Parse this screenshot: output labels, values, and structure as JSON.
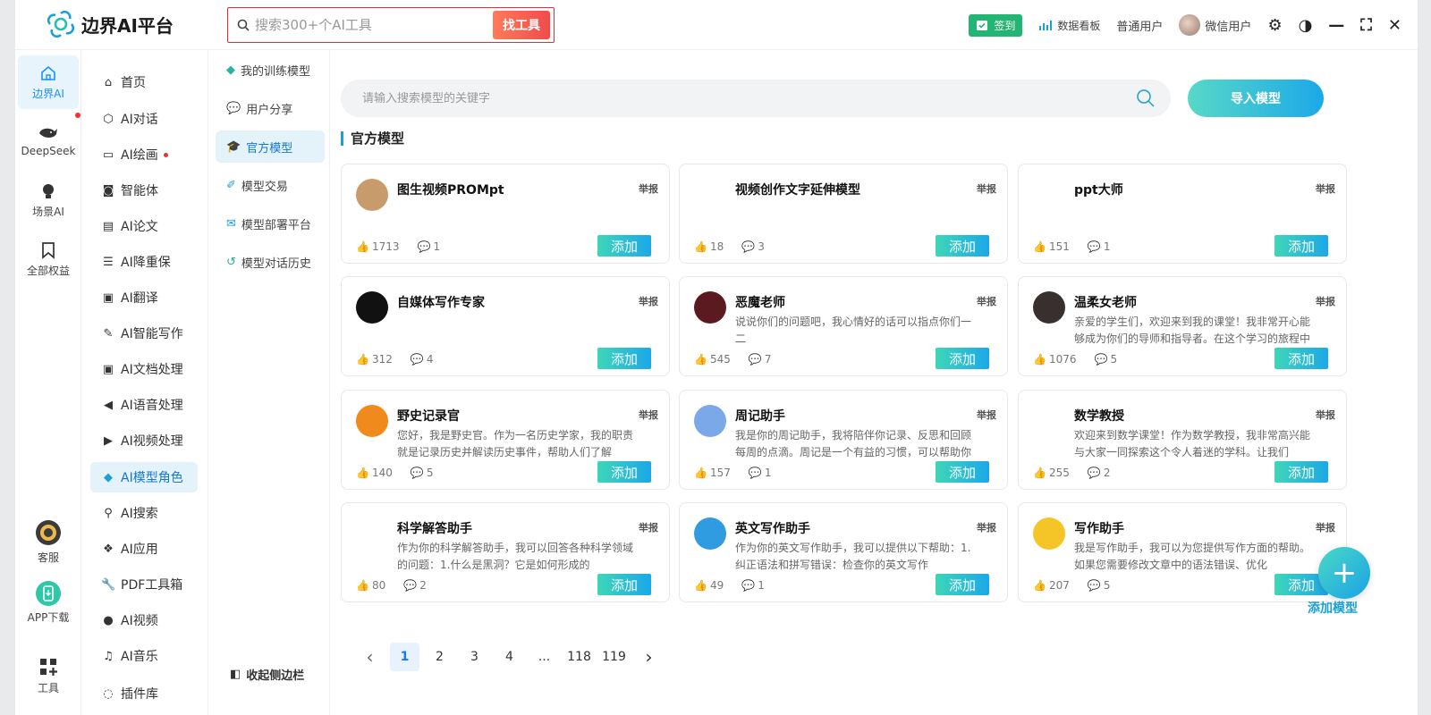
{
  "app": {
    "title": "边界AI平台"
  },
  "search": {
    "placeholder": "搜索300+个AI工具",
    "button": "找工具"
  },
  "topbar": {
    "signin": "签到",
    "dashboard": "数据看板",
    "user_level": "普通用户",
    "user_name": "微信用户"
  },
  "rail": [
    {
      "label": "边界AI",
      "icon": "home-icon"
    },
    {
      "label": "DeepSeek",
      "icon": "whale-icon"
    },
    {
      "label": "场景AI",
      "icon": "bulb-icon"
    },
    {
      "label": "全部权益",
      "icon": "bookmark-icon"
    },
    {
      "label": "客服",
      "icon": "support-icon"
    },
    {
      "label": "APP下载",
      "icon": "phone-icon"
    },
    {
      "label": "工具",
      "icon": "grid-icon"
    }
  ],
  "menu": [
    {
      "label": "首页",
      "icon": "home-icon"
    },
    {
      "label": "AI对话",
      "icon": "cube-icon"
    },
    {
      "label": "AI绘画",
      "icon": "image-icon"
    },
    {
      "label": "智能体",
      "icon": "robot-icon"
    },
    {
      "label": "AI论文",
      "icon": "doc-icon"
    },
    {
      "label": "AI降重保",
      "icon": "list-icon"
    },
    {
      "label": "AI翻译",
      "icon": "translate-icon"
    },
    {
      "label": "AI智能写作",
      "icon": "pen-icon"
    },
    {
      "label": "AI文档处理",
      "icon": "text-icon"
    },
    {
      "label": "AI语音处理",
      "icon": "speaker-icon"
    },
    {
      "label": "AI视频处理",
      "icon": "video-icon"
    },
    {
      "label": "AI模型角色",
      "icon": "cube-icon"
    },
    {
      "label": "AI搜索",
      "icon": "search-icon"
    },
    {
      "label": "AI应用",
      "icon": "apps-icon"
    },
    {
      "label": "PDF工具箱",
      "icon": "wrench-icon"
    },
    {
      "label": "AI视频",
      "icon": "play-icon"
    },
    {
      "label": "AI音乐",
      "icon": "music-icon"
    },
    {
      "label": "插件库",
      "icon": "plugin-icon"
    }
  ],
  "submenu": [
    {
      "label": "我的训练模型"
    },
    {
      "label": "用户分享"
    },
    {
      "label": "官方模型"
    },
    {
      "label": "模型交易"
    },
    {
      "label": "模型部署平台"
    },
    {
      "label": "模型对话历史"
    }
  ],
  "collapse": "收起侧边栏",
  "main": {
    "search_placeholder": "请输入搜索模型的关键字",
    "import": "导入模型",
    "section": "官方模型",
    "report": "举报",
    "add": "添加"
  },
  "cards": [
    {
      "title": "图生视频PROMpt",
      "desc": "",
      "likes": "1713",
      "comments": "1",
      "avatar": "dog-avatar",
      "color": "#c89b6d"
    },
    {
      "title": "视频创作文字延伸模型",
      "desc": "",
      "likes": "18",
      "comments": "3",
      "avatar": "blank-avatar",
      "color": "#ffffff"
    },
    {
      "title": "ppt大师",
      "desc": "",
      "likes": "151",
      "comments": "1",
      "avatar": "openai-avatar",
      "color": "#ffffff"
    },
    {
      "title": "自媒体写作专家",
      "desc": "",
      "likes": "312",
      "comments": "4",
      "avatar": "openai-dark-avatar",
      "color": "#111111"
    },
    {
      "title": "恶魔老师",
      "desc": "说说你们的问题吧，我心情好的话可以指点你们一二",
      "likes": "545",
      "comments": "7",
      "avatar": "demon-avatar",
      "color": "#5a1a1f"
    },
    {
      "title": "温柔女老师",
      "desc": "亲爱的学生们，欢迎来到我的课堂！我非常开心能够成为你们的导师和指导者。在这个学习的旅程中",
      "likes": "1076",
      "comments": "5",
      "avatar": "teacher-avatar",
      "color": "#3a2f2f"
    },
    {
      "title": "野史记录官",
      "desc": "您好，我是野史官。作为一名历史学家，我的职责就是记录历史并解读历史事件，帮助人们了解",
      "likes": "140",
      "comments": "5",
      "avatar": "book-avatar",
      "color": "#f08a1c"
    },
    {
      "title": "周记助手",
      "desc": "我是你的周记助手，我将陪伴你记录、反思和回顾每周的点滴。周记是一个有益的习惯，可以帮助你",
      "likes": "157",
      "comments": "1",
      "avatar": "notepad-avatar",
      "color": "#7aa8e8"
    },
    {
      "title": "数学教授",
      "desc": "欢迎来到数学课堂！作为数学教授，我非常高兴能与大家一同探索这个令人着迷的学科。让我们",
      "likes": "255",
      "comments": "2",
      "avatar": "professor-avatar",
      "color": "#ffffff"
    },
    {
      "title": "科学解答助手",
      "desc": "作为你的科学解答助手，我可以回答各种科学领域的问题：1.什么是黑洞？它是如何形成的",
      "likes": "80",
      "comments": "2",
      "avatar": "bulb-avatar",
      "color": "#ffffff"
    },
    {
      "title": "英文写作助手",
      "desc": "作为你的英文写作助手，我可以提供以下帮助：1.纠正语法和拼写错误：检查你的英文写作",
      "likes": "49",
      "comments": "1",
      "avatar": "writing-avatar",
      "color": "#2f9be0"
    },
    {
      "title": "写作助手",
      "desc": "我是写作助手，我可以为您提供写作方面的帮助。如果您需要修改文章中的语法错误、优化",
      "likes": "207",
      "comments": "5",
      "avatar": "paper-avatar",
      "color": "#f5c528"
    }
  ],
  "pagination": [
    "1",
    "2",
    "3",
    "4",
    "...",
    "118",
    "119"
  ],
  "fab": {
    "label": "添加模型"
  }
}
